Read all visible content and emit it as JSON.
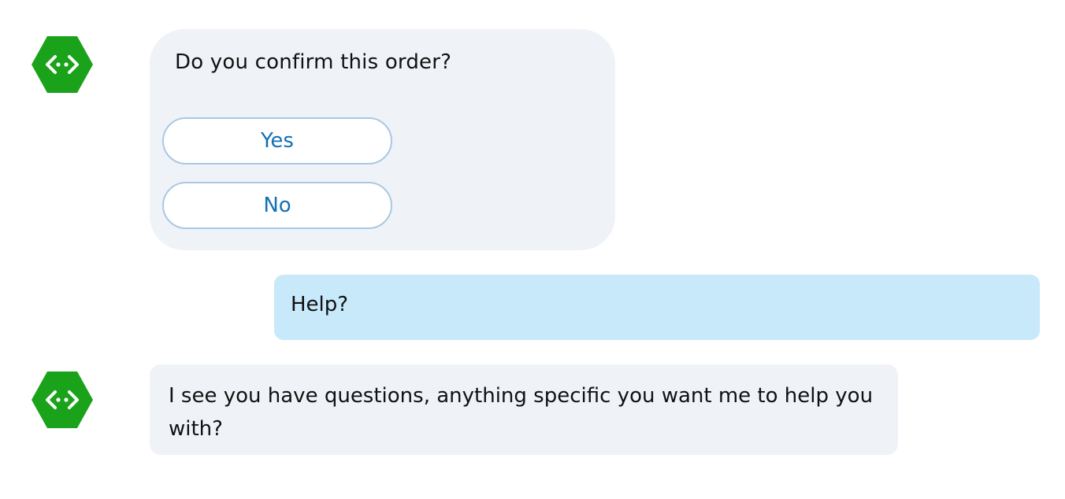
{
  "colors": {
    "bot_avatar": "#1aa31a",
    "bot_bubble": "#eff2f7",
    "user_bubble": "#c7e9fa",
    "button_text": "#1270b5",
    "button_border": "#a9c8e3"
  },
  "messages": [
    {
      "from": "bot",
      "avatar_icon": "bot-code-hexagon-icon",
      "text": "Do you confirm this order?",
      "choices": [
        {
          "label": "Yes"
        },
        {
          "label": "No"
        }
      ]
    },
    {
      "from": "user",
      "text": "Help?"
    },
    {
      "from": "bot",
      "avatar_icon": "bot-code-hexagon-icon",
      "text": "I see you have questions, anything specific you want me to help you with?"
    }
  ]
}
